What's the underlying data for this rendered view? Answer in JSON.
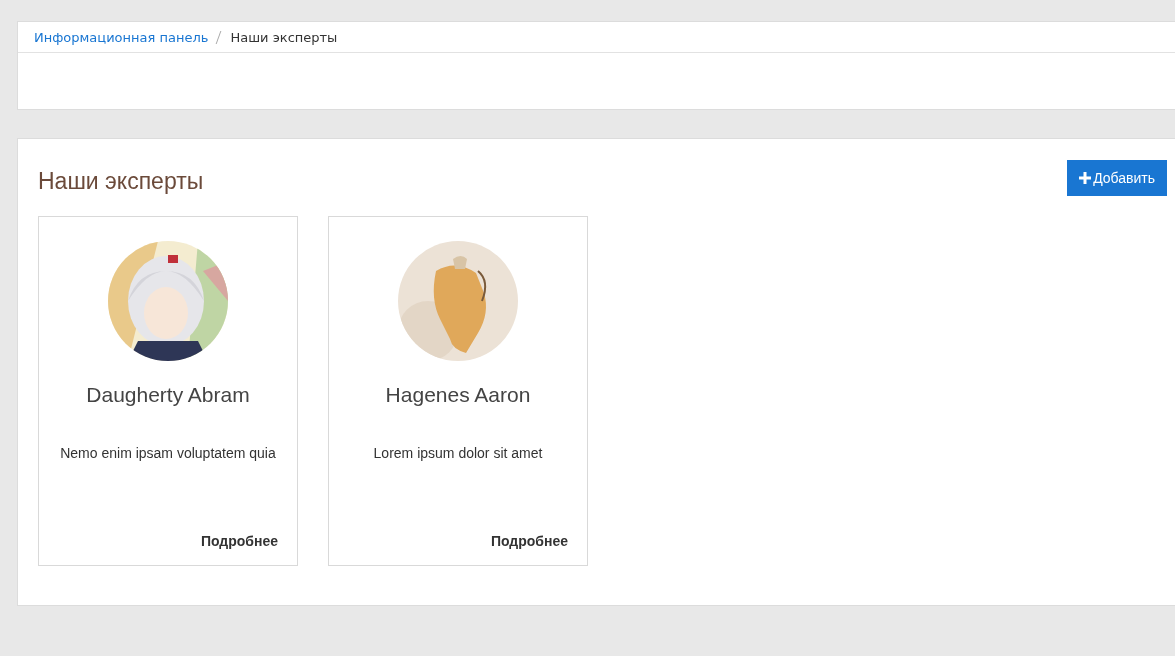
{
  "breadcrumb": [
    {
      "label": "Информационная панель",
      "kind": "link"
    },
    {
      "label": "Наши эксперты",
      "kind": "current"
    }
  ],
  "section": {
    "title": "Наши эксперты",
    "add_button": "Добавить"
  },
  "experts": [
    {
      "name": "Daugherty Abram",
      "description": "Nemo enim ipsam voluptatem quia",
      "more": "Подробнее"
    },
    {
      "name": "Hagenes Aaron",
      "description": "Lorem ipsum dolor sit amet",
      "more": "Подробнее"
    }
  ]
}
